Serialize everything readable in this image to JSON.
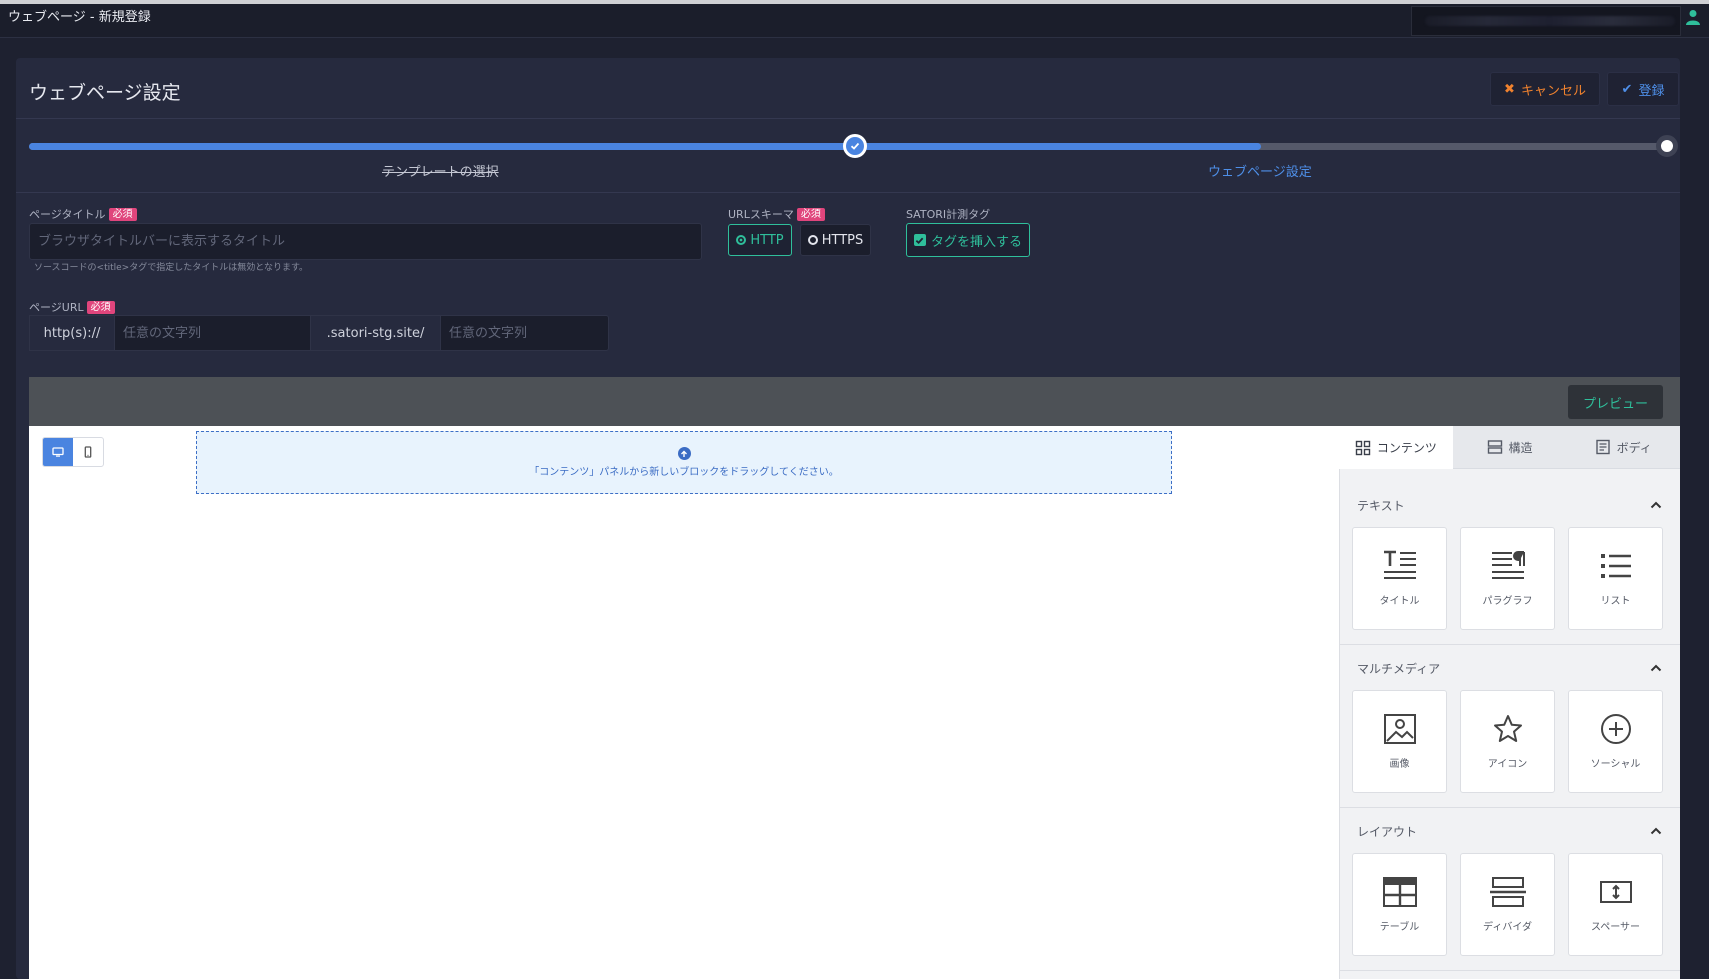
{
  "window": {
    "title": "ウェブページ - 新規登録"
  },
  "header": {
    "title": "ウェブページ設定",
    "cancel_label": "キャンセル",
    "register_label": "登録"
  },
  "stepper": {
    "steps": [
      {
        "label": "テンプレートの選択",
        "status": "completed"
      },
      {
        "label": "ウェブページ設定",
        "status": "current"
      }
    ],
    "progress_fraction": 0.75
  },
  "form": {
    "required_badge": "必須",
    "page_title": {
      "label": "ページタイトル",
      "placeholder": "ブラウザタイトルバーに表示するタイトル",
      "value": "",
      "help": "ソースコードの<title>タグで指定したタイトルは無効となります。"
    },
    "url_scheme": {
      "label": "URLスキーマ",
      "options": [
        "HTTP",
        "HTTPS"
      ],
      "selected": "HTTP"
    },
    "satori_tag": {
      "label": "SATORI計測タグ",
      "button_label": "タグを挿入する",
      "checked": true
    },
    "page_url": {
      "label": "ページURL",
      "prefix": "http(s)://",
      "subdomain_placeholder": "任意の文字列",
      "domain": ".satori-stg.site/",
      "path_placeholder": "任意の文字列"
    }
  },
  "editor": {
    "preview_label": "プレビュー",
    "device_modes": [
      "desktop",
      "mobile"
    ],
    "active_device": "desktop",
    "dropzone_text": "「コンテンツ」パネルから新しいブロックをドラッグしてください。"
  },
  "sidebar": {
    "tabs": [
      {
        "label": "コンテンツ",
        "icon": "grid-icon",
        "active": true
      },
      {
        "label": "構造",
        "icon": "rows-icon",
        "active": false
      },
      {
        "label": "ボディ",
        "icon": "document-icon",
        "active": false
      }
    ],
    "sections": [
      {
        "title": "テキスト",
        "items": [
          {
            "label": "タイトル",
            "icon": "title-icon"
          },
          {
            "label": "パラグラフ",
            "icon": "paragraph-icon"
          },
          {
            "label": "リスト",
            "icon": "list-icon"
          }
        ]
      },
      {
        "title": "マルチメディア",
        "items": [
          {
            "label": "画像",
            "icon": "image-icon"
          },
          {
            "label": "アイコン",
            "icon": "star-icon"
          },
          {
            "label": "ソーシャル",
            "icon": "plus-circle-icon"
          }
        ]
      },
      {
        "title": "レイアウト",
        "items": [
          {
            "label": "テーブル",
            "icon": "table-icon"
          },
          {
            "label": "ディバイダ",
            "icon": "divider-icon"
          },
          {
            "label": "スペーサー",
            "icon": "spacer-icon"
          }
        ]
      }
    ]
  },
  "colors": {
    "accent_blue": "#4a84e0",
    "accent_green": "#2fbf9b",
    "accent_orange": "#f0822e",
    "required_pink": "#e0457c",
    "panel_bg": "#262a3e"
  }
}
